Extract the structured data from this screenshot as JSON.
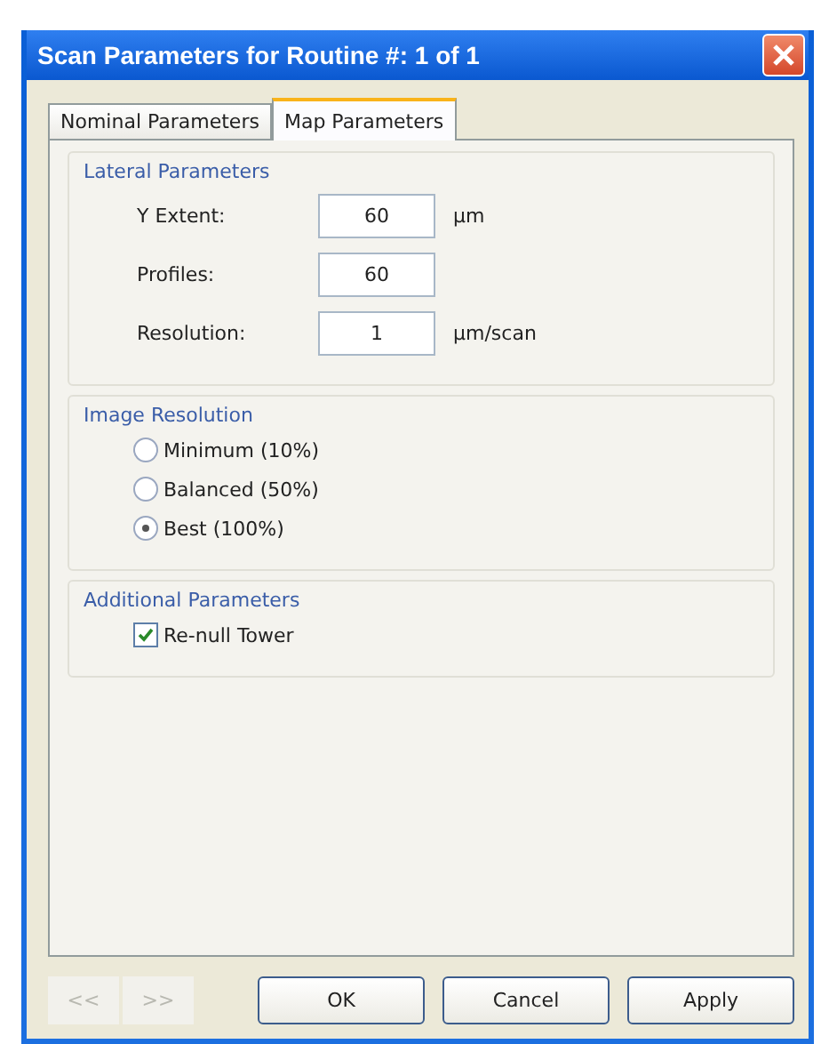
{
  "window": {
    "title": "Scan Parameters for Routine #: 1 of 1"
  },
  "tabs": [
    {
      "label": "Nominal Parameters",
      "selected": false
    },
    {
      "label": "Map Parameters",
      "selected": true
    }
  ],
  "lateral_parameters": {
    "title": "Lateral Parameters",
    "fields": [
      {
        "label": "Y Extent:",
        "value": "60",
        "unit": "µm"
      },
      {
        "label": "Profiles:",
        "value": "60"
      },
      {
        "label": "Resolution:",
        "value": "1",
        "unit": "µm/scan"
      }
    ]
  },
  "image_resolution": {
    "title": "Image Resolution",
    "options": [
      {
        "label": "Minimum (10%)",
        "selected": false
      },
      {
        "label": "Balanced (50%)",
        "selected": false
      },
      {
        "label": "Best (100%)",
        "selected": true
      }
    ]
  },
  "additional_parameters": {
    "title": "Additional Parameters",
    "options": [
      {
        "label": "Re-null Tower",
        "checked": true
      }
    ]
  },
  "nav_buttons": [
    {
      "label": "<<",
      "disabled": true
    },
    {
      "label": ">>",
      "disabled": true
    }
  ],
  "buttons": [
    "OK",
    "Cancel",
    "Apply"
  ]
}
